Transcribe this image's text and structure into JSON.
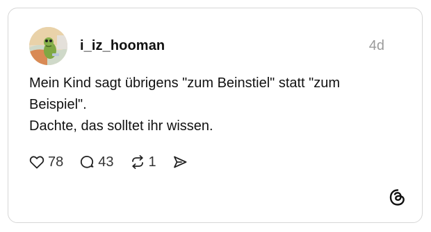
{
  "post": {
    "username": "i_iz_hooman",
    "time": "4d",
    "text_lines": [
      "Mein Kind sagt übrigens \"zum Beinstiel\" statt \"zum",
      "Beispiel\".",
      "Dachte, das solltet ihr wissen."
    ]
  },
  "actions": {
    "likes": "78",
    "replies": "43",
    "reposts": "1",
    "like_icon": "heart-outline-icon",
    "reply_icon": "speech-bubble-icon",
    "repost_icon": "repost-arrows-icon",
    "share_icon": "send-arrow-icon"
  },
  "branding": {
    "logo_icon": "threads-logo-icon"
  },
  "colors": {
    "border": "#d6d6d6",
    "text": "#111111",
    "muted": "#9a9a9a"
  }
}
